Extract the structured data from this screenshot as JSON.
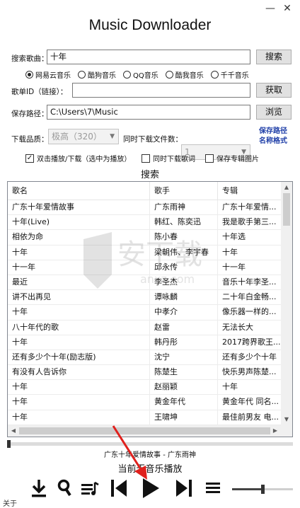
{
  "window": {
    "minimize": "—",
    "close": "✕"
  },
  "app": {
    "title": "Music Downloader"
  },
  "search": {
    "label": "搜索歌曲：",
    "value": "十年",
    "button": "搜索"
  },
  "sources": [
    {
      "label": "网易云音乐",
      "selected": true
    },
    {
      "label": "酷狗音乐",
      "selected": false
    },
    {
      "label": "QQ音乐",
      "selected": false
    },
    {
      "label": "酷我音乐",
      "selected": false
    },
    {
      "label": "千千音乐",
      "selected": false
    }
  ],
  "song_id": {
    "label": "歌单ID（链接）：",
    "value": "",
    "button": "获取"
  },
  "save": {
    "label": "保存路径：",
    "value": "C:\\Users\\7\\Music",
    "button": "浏览"
  },
  "quality": {
    "label": "下载品质：",
    "value": "极高（320）"
  },
  "concurrent": {
    "label": "同时下载文件数：",
    "value": "1"
  },
  "links": {
    "line1": "保存路径",
    "line2": "名称格式"
  },
  "options": [
    {
      "label": "双击播放/下载（选中为播放）",
      "checked": true
    },
    {
      "label": "同时下载歌词",
      "checked": false
    },
    {
      "label": "保存专辑图片",
      "checked": false
    }
  ],
  "section": {
    "title": "搜索"
  },
  "table": {
    "headers": [
      "歌名",
      "歌手",
      "专辑"
    ],
    "rows": [
      [
        "广东十年爱情故事",
        "广东雨神",
        "广东十年爱情..."
      ],
      [
        "十年(Live)",
        "韩红、陈奕迅",
        "我是歌手第三..."
      ],
      [
        "相依为命",
        "陈小春",
        "十年选"
      ],
      [
        "十年",
        "梁朝伟、李宇春",
        "十年"
      ],
      [
        "十一年",
        "邱永传",
        "十一年"
      ],
      [
        "最近",
        "李圣杰",
        "音乐十年李圣..."
      ],
      [
        "讲不出再见",
        "谭咏麟",
        "二十年白金畅..."
      ],
      [
        "十年",
        "中孝介",
        "像乐器一样的..."
      ],
      [
        "八十年代的歌",
        "赵雷",
        "无法长大"
      ],
      [
        "十年",
        "韩丹彤",
        "2017跨界歌王..."
      ],
      [
        "还有多少个十年(励志版)",
        "沈宁",
        "还有多少个十年"
      ],
      [
        "有没有人告诉你",
        "陈楚生",
        "快乐男声陈楚..."
      ],
      [
        "十年",
        "赵丽颖",
        "十年"
      ],
      [
        "十年",
        "黄金年代",
        "黄金年代 同名..."
      ],
      [
        "十年",
        "王啸坤",
        "最佳前男友 电..."
      ]
    ]
  },
  "player": {
    "now_playing": "广东十年爱情故事 - 广东雨神",
    "status": "当前无音乐播放"
  },
  "footer": {
    "about": "关于"
  },
  "watermark": {
    "text": "安下载",
    "sub": "anxz.com"
  }
}
